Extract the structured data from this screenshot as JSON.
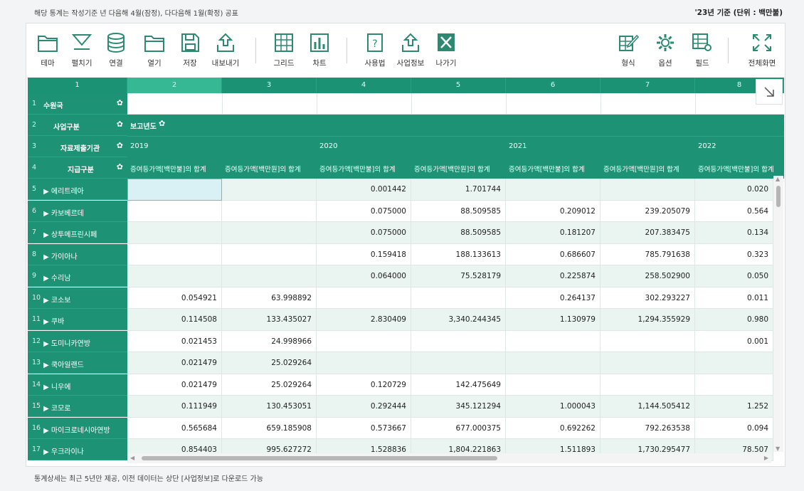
{
  "top_note": "해당 통계는 작성기준 년 다음해 4월(잠정), 다다음해 1월(확정) 공표",
  "top_unit": "'23년 기준 (단위 : 백만불)",
  "bottom_note": "통계상세는 최근 5년만 제공, 이전 데이터는 상단 [사업정보]로 다운로드 가능",
  "toolbar": {
    "theme": "테마",
    "expand": "펼치기",
    "connect": "연결",
    "open": "열기",
    "save": "저장",
    "export": "내보내기",
    "grid": "그리드",
    "chart": "차트",
    "usage": "사용법",
    "bizinfo": "사업정보",
    "exit": "나가기",
    "format": "형식",
    "options": "옵션",
    "fields": "필드",
    "fullscreen": "전체화면"
  },
  "col_numbers": [
    "1",
    "2",
    "3",
    "4",
    "5",
    "6",
    "7",
    "8"
  ],
  "dims": {
    "r1": {
      "num": "1",
      "label": "수원국"
    },
    "r2": {
      "num": "2",
      "label": "사업구분"
    },
    "r3": {
      "num": "3",
      "label": "자료제출기관"
    },
    "r4": {
      "num": "4",
      "label": "지급구분"
    },
    "report_year": "보고년도"
  },
  "years": [
    "2019",
    "2020",
    "2021",
    "2022"
  ],
  "measure_usd": "증여등가액[백만불]의 합계",
  "measure_krw": "증여등가액[백만원]의 합계",
  "rows": [
    {
      "num": "5",
      "name": "▶ 에리트레아",
      "v": [
        "",
        "",
        "0.001442",
        "1.701744",
        "",
        "",
        "0.020"
      ]
    },
    {
      "num": "6",
      "name": "▶ 카보베르데",
      "v": [
        "",
        "",
        "0.075000",
        "88.509585",
        "0.209012",
        "239.205079",
        "0.564"
      ]
    },
    {
      "num": "7",
      "name": "▶ 상투메프린시페",
      "v": [
        "",
        "",
        "0.075000",
        "88.509585",
        "0.181207",
        "207.383475",
        "0.134"
      ]
    },
    {
      "num": "8",
      "name": "▶ 가이아나",
      "v": [
        "",
        "",
        "0.159418",
        "188.133613",
        "0.686607",
        "785.791638",
        "0.323"
      ]
    },
    {
      "num": "9",
      "name": "▶ 수리남",
      "v": [
        "",
        "",
        "0.064000",
        "75.528179",
        "0.225874",
        "258.502900",
        "0.050"
      ]
    },
    {
      "num": "10",
      "name": "▶ 코소보",
      "v": [
        "0.054921",
        "63.998892",
        "",
        "",
        "0.264137",
        "302.293227",
        "0.011"
      ]
    },
    {
      "num": "11",
      "name": "▶ 쿠바",
      "v": [
        "0.114508",
        "133.435027",
        "2.830409",
        "3,340.244345",
        "1.130979",
        "1,294.355929",
        "0.980"
      ]
    },
    {
      "num": "12",
      "name": "▶ 도미니카연방",
      "v": [
        "0.021453",
        "24.998966",
        "",
        "",
        "",
        "",
        "0.001"
      ]
    },
    {
      "num": "13",
      "name": "▶ 쿡아일랜드",
      "v": [
        "0.021479",
        "25.029264",
        "",
        "",
        "",
        "",
        ""
      ]
    },
    {
      "num": "14",
      "name": "▶ 니우에",
      "v": [
        "0.021479",
        "25.029264",
        "0.120729",
        "142.475649",
        "",
        "",
        ""
      ]
    },
    {
      "num": "15",
      "name": "▶ 코모로",
      "v": [
        "0.111949",
        "130.453051",
        "0.292444",
        "345.121294",
        "1.000043",
        "1,144.505412",
        "1.252"
      ]
    },
    {
      "num": "16",
      "name": "▶ 마이크로네시아연방",
      "v": [
        "0.565684",
        "659.185908",
        "0.573667",
        "677.000375",
        "0.692262",
        "792.263538",
        "0.094"
      ]
    },
    {
      "num": "17",
      "name": "▶ 우크라이나",
      "v": [
        "0.854403",
        "995.627272",
        "1.528836",
        "1,804.221863",
        "1.511893",
        "1,730.295477",
        "78.507"
      ]
    }
  ],
  "colors": {
    "header_green": "#1e9275",
    "accent_teal": "#36b894",
    "selected_cell": "#d9f1f4"
  }
}
